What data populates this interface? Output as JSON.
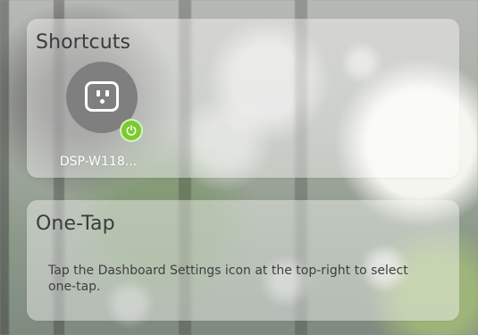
{
  "shortcuts": {
    "title": "Shortcuts",
    "items": [
      {
        "label": "DSP-W118...",
        "icon": "smart-plug-icon",
        "status": "on",
        "status_icon": "power-icon",
        "status_color": "#7acb2f"
      }
    ]
  },
  "one_tap": {
    "title": "One-Tap",
    "description": "Tap the Dashboard Settings icon at the top-right to select one-tap."
  }
}
